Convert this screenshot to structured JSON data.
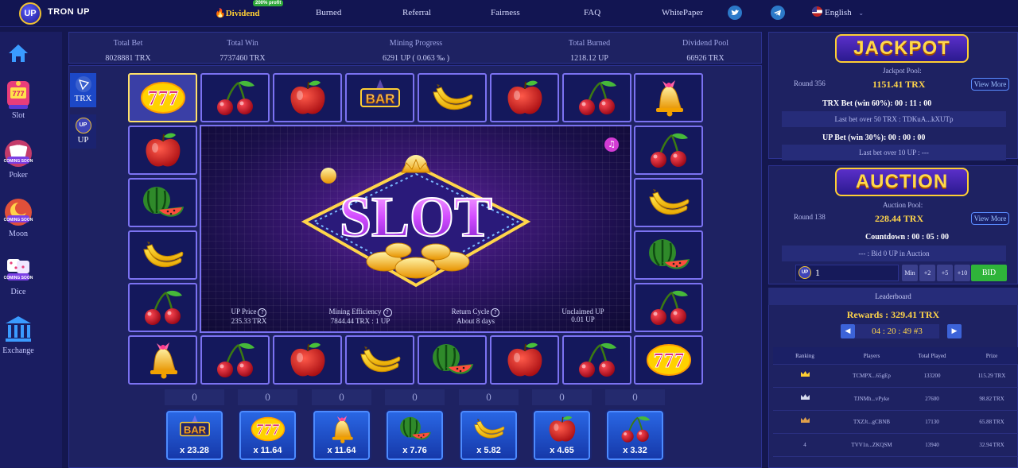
{
  "header": {
    "brand_badge": "UP",
    "brand": "TRON UP",
    "nav": [
      {
        "label": "Dividend",
        "badge": "200% profit",
        "highlight": true
      },
      {
        "label": "Burned"
      },
      {
        "label": "Referral"
      },
      {
        "label": "Fairness"
      },
      {
        "label": "FAQ"
      },
      {
        "label": "WhitePaper"
      }
    ],
    "language": "English",
    "icons": [
      "twitter-icon",
      "telegram-icon",
      "us-flag-icon",
      "chevron-down-icon"
    ]
  },
  "sidebar": [
    {
      "label": "Slot",
      "icon": "slot-machine-icon"
    },
    {
      "label": "Poker",
      "icon": "poker-icon",
      "badge": "COMING SOON"
    },
    {
      "label": "Moon",
      "icon": "moon-icon",
      "badge": "COMING SOON"
    },
    {
      "label": "Dice",
      "icon": "dice-icon",
      "badge": "COMING SOON"
    },
    {
      "label": "Exchange",
      "icon": "exchange-bank-icon"
    }
  ],
  "stats": [
    {
      "label": "Total Bet",
      "value": "8028881 TRX"
    },
    {
      "label": "Total Win",
      "value": "7737460 TRX"
    },
    {
      "label": "Mining Progress",
      "value": "6291 UP ( 0.063 ‰ )"
    },
    {
      "label": "Total Burned",
      "value": "1218.12 UP"
    },
    {
      "label": "Dividend Pool",
      "value": "66926 TRX"
    }
  ],
  "currency_tabs": [
    {
      "label": "TRX",
      "selected": true
    },
    {
      "label": "UP",
      "selected": false
    }
  ],
  "reels": {
    "top": [
      "777",
      "cherry",
      "apple",
      "bar",
      "banana",
      "apple",
      "cherry",
      "bell"
    ],
    "left": [
      "apple",
      "watermelon",
      "banana",
      "cherry"
    ],
    "right": [
      "cherry",
      "banana",
      "watermelon",
      "cherry"
    ],
    "bottom": [
      "bell",
      "cherry",
      "apple",
      "banana",
      "watermelon",
      "apple",
      "cherry",
      "777"
    ],
    "active_index": 0
  },
  "center": {
    "logo": "SLOT",
    "info": [
      {
        "label": "UP Price",
        "value": "235.33 TRX",
        "help": "?"
      },
      {
        "label": "Mining Efficiency",
        "value": "7844.44 TRX : 1 UP",
        "help": "?"
      },
      {
        "label": "Return Cycle",
        "value": "About 8 days",
        "help": "?"
      },
      {
        "label": "Unclaimed UP",
        "value": "0.01 UP"
      }
    ]
  },
  "bets": [
    {
      "symbol": "bar",
      "count": "0",
      "multiplier": "x 23.28"
    },
    {
      "symbol": "777",
      "count": "0",
      "multiplier": "x 11.64"
    },
    {
      "symbol": "bell",
      "count": "0",
      "multiplier": "x 11.64"
    },
    {
      "symbol": "watermelon",
      "count": "0",
      "multiplier": "x 7.76"
    },
    {
      "symbol": "banana",
      "count": "0",
      "multiplier": "x 5.82"
    },
    {
      "symbol": "apple",
      "count": "0",
      "multiplier": "x 4.65"
    },
    {
      "symbol": "cherry",
      "count": "0",
      "multiplier": "x 3.32"
    }
  ],
  "jackpot": {
    "title": "JACKPOT",
    "pool_label": "Jackpot Pool:",
    "round": "Round 356",
    "pool": "1151.41 TRX",
    "view_more": "View More",
    "trx_bet": "TRX Bet (win 60%): 00 : 11 : 00",
    "trx_last": "Last bet over 50 TRX : TDKuA...kXUTp",
    "up_bet": "UP Bet (win 30%): 00 : 00 : 00",
    "up_last": "Last bet over 10 UP : ---"
  },
  "auction": {
    "title": "AUCTION",
    "pool_label": "Auction Pool:",
    "round": "Round 138",
    "pool": "228.44 TRX",
    "view_more": "View More",
    "countdown": "Countdown : 00 : 05 : 00",
    "status": "--- : Bid 0 UP in Auction",
    "input_value": "1",
    "input_badge": "UP",
    "min_label": "Min",
    "plus2": "+2",
    "plus5": "+5",
    "plus10": "+10",
    "bid_label": "BID"
  },
  "leaderboard": {
    "title": "Leaderboard",
    "rewards": "Rewards : 329.41 TRX",
    "timer": "04 : 20 : 49 #3",
    "prev": "◀",
    "next": "▶",
    "columns": [
      "Ranking",
      "Players",
      "Total Played",
      "Prize"
    ],
    "rows": [
      {
        "rank": "crown-gold",
        "player": "TCMPX...65gEp",
        "played": "133200",
        "prize": "115.29 TRX"
      },
      {
        "rank": "crown-silver",
        "player": "TJNMh...vPyke",
        "played": "27600",
        "prize": "98.82 TRX"
      },
      {
        "rank": "crown-bronze",
        "player": "TXZJt...gCBNB",
        "played": "17130",
        "prize": "65.88 TRX"
      },
      {
        "rank": "4",
        "player": "TVV1n...ZKQSM",
        "played": "13940",
        "prize": "32.94 TRX"
      }
    ]
  },
  "colors": {
    "background": "#14174f",
    "panel": "#1e2262",
    "accent_gold": "#ffd54a",
    "tile_border": "#7b72f1",
    "bid_green": "#2fb43a",
    "button_blue": "#2a68e6"
  }
}
